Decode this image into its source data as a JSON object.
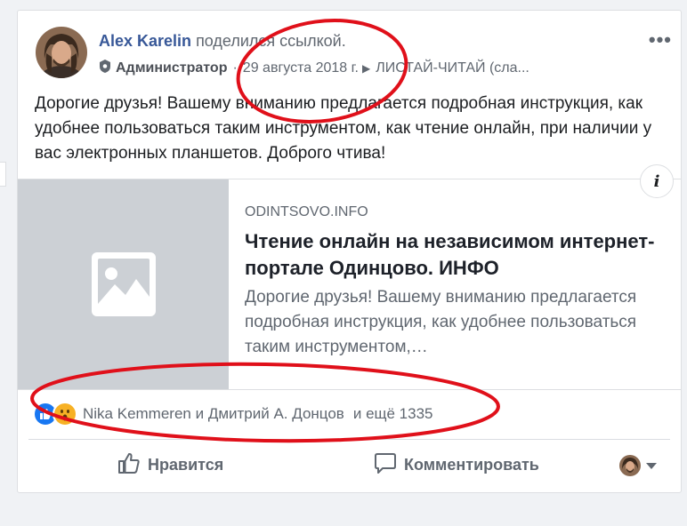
{
  "post": {
    "author": "Alex Karelin",
    "action": "поделился ссылкой.",
    "role": "Администратор",
    "date": "29 августа 2018 г.",
    "group": "ЛИСТАЙ-ЧИТАЙ (сла...",
    "text": "Дорогие друзья! Вашему вниманию предлагается подробная инструкция, как удобнее пользоваться таким инструментом, как чтение онлайн, при наличии у вас электронных планшетов. Доброго чтива!"
  },
  "link_preview": {
    "domain": "ODINTSOVO.INFO",
    "title": "Чтение онлайн на независимом интернет-портале Одинцово. ИНФО",
    "description": "Дорогие друзья! Вашему вниманию предлагается подробная инструкция, как удобнее пользоваться таким инструментом,…",
    "info_label": "i"
  },
  "reactions": {
    "names": "Nika Kemmeren и Дмитрий А. Донцов",
    "more": "и ещё 1335",
    "icons": [
      "like-reaction-icon",
      "wow-reaction-icon"
    ]
  },
  "actions": {
    "like_label": "Нравится",
    "comment_label": "Комментировать"
  },
  "colors": {
    "link_blue": "#385898",
    "annotation_red": "#e0101a",
    "like_blue": "#1877f2"
  }
}
